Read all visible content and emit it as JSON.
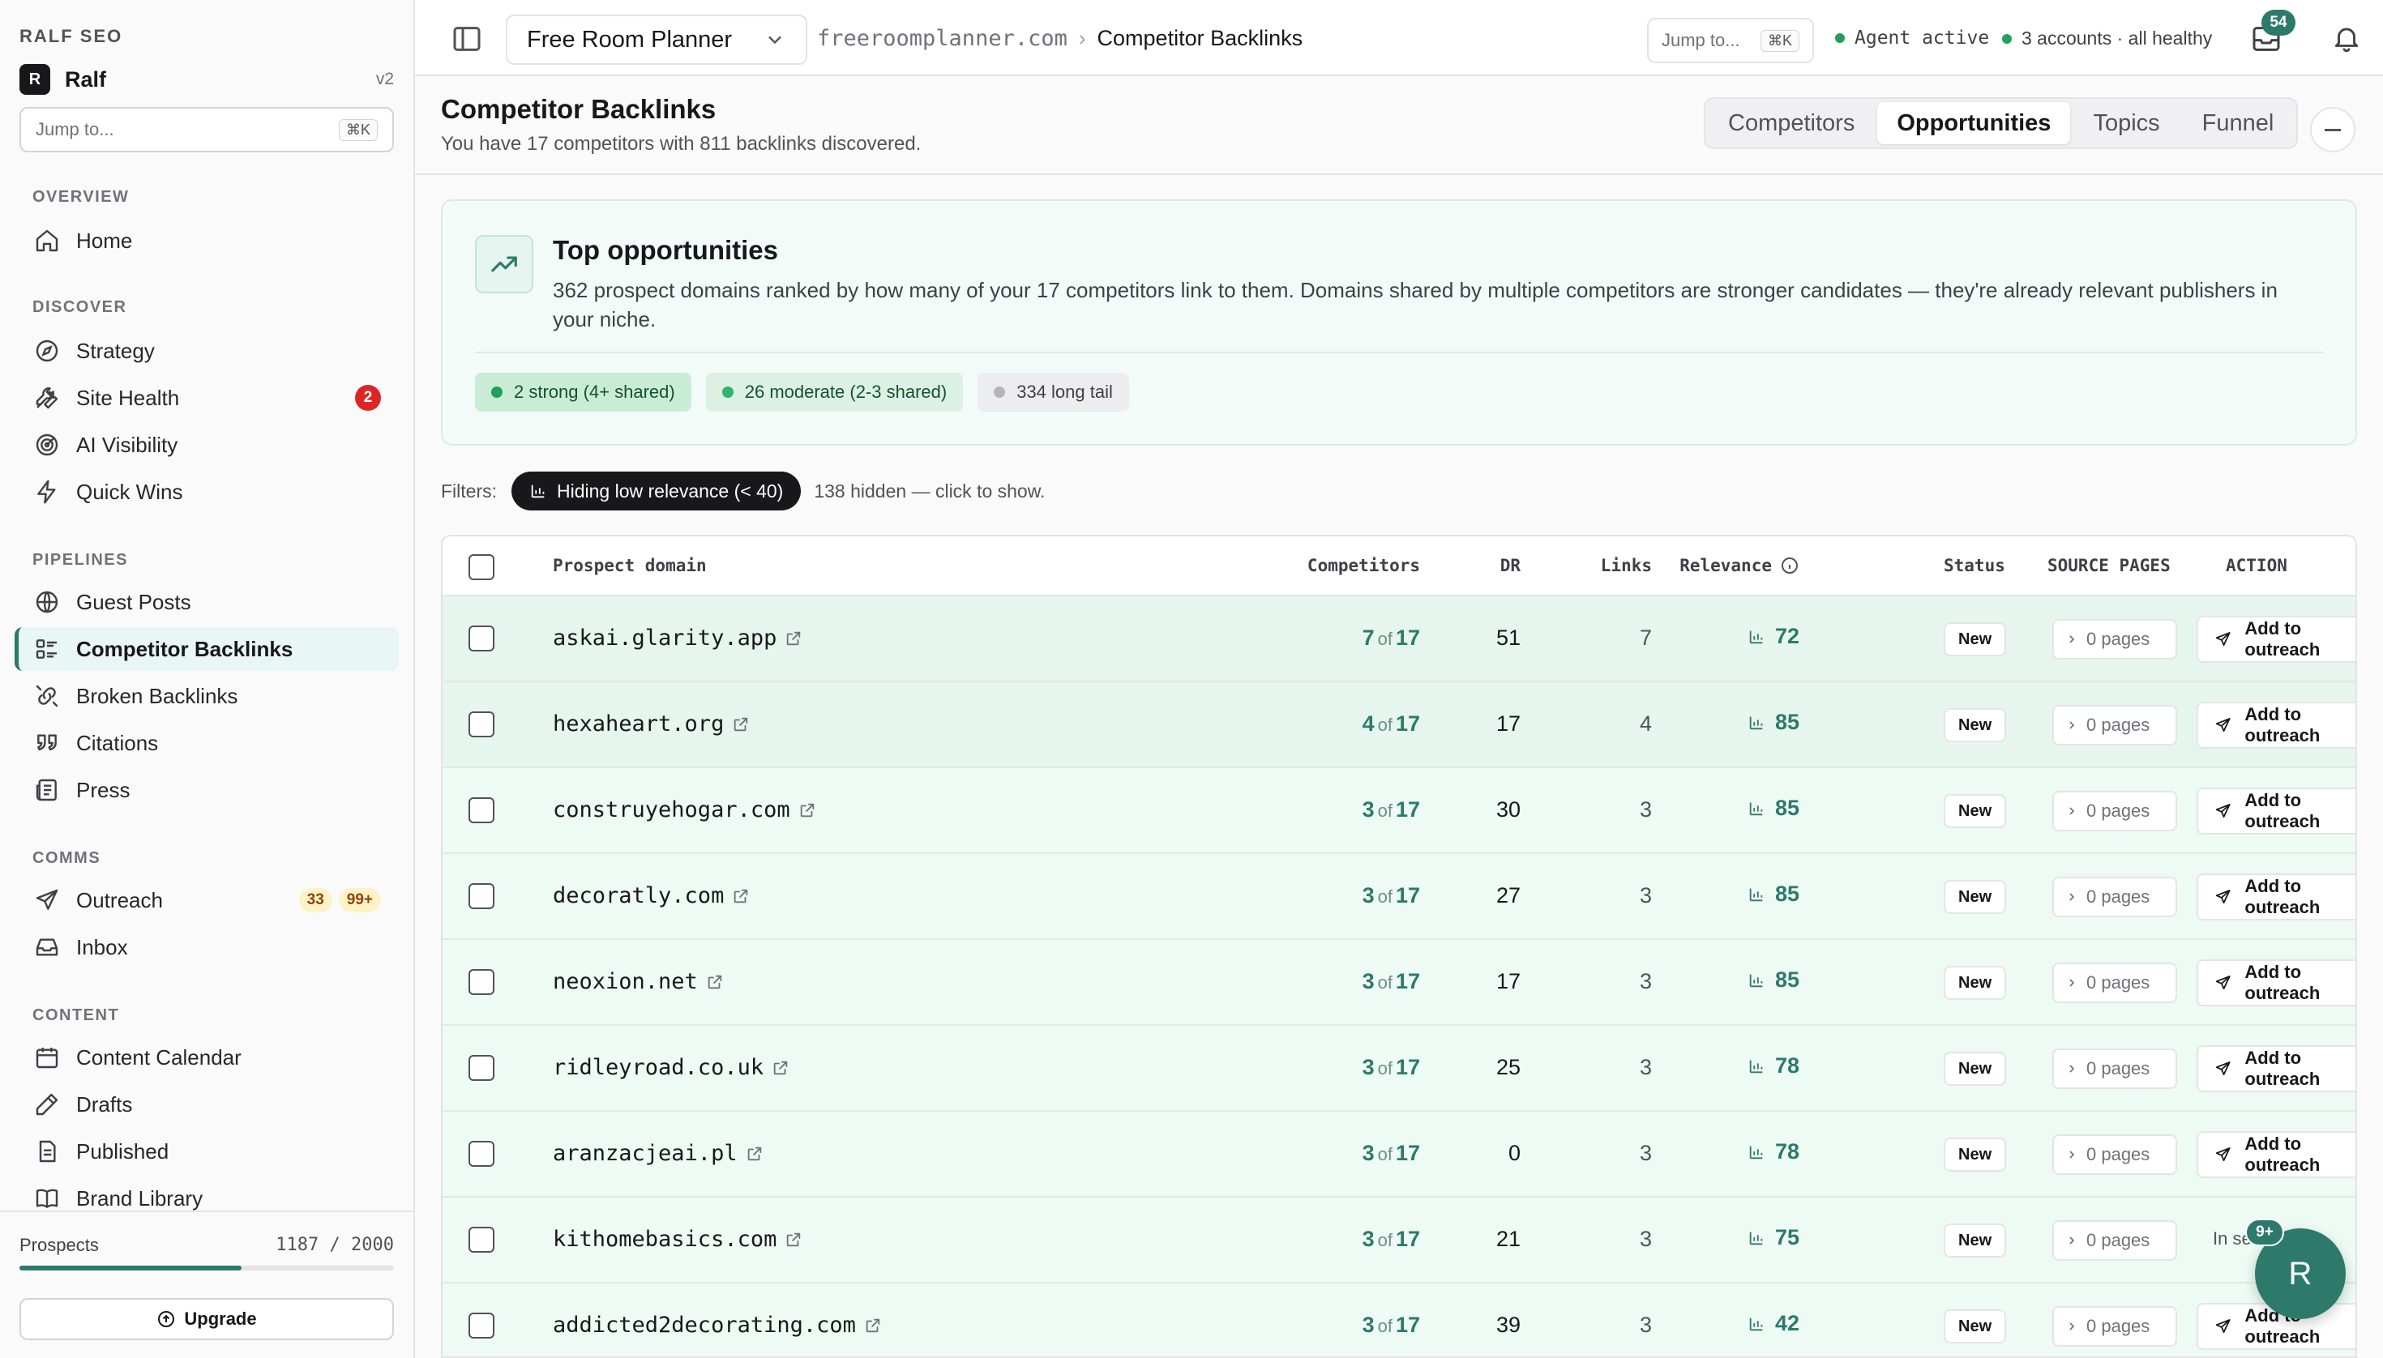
{
  "sidebar": {
    "brand_top": "RALF SEO",
    "brand_avatar": "R",
    "brand_name": "Ralf",
    "version": "v2",
    "jump_placeholder": "Jump to...",
    "jump_shortcut": "⌘K",
    "sections": {
      "overview": "OVERVIEW",
      "discover": "DISCOVER",
      "pipelines": "PIPELINES",
      "comms": "COMMS",
      "content": "CONTENT"
    },
    "items": {
      "home": {
        "label": "Home",
        "icon": "home-icon"
      },
      "strategy": {
        "label": "Strategy",
        "icon": "compass-icon"
      },
      "site_health": {
        "label": "Site Health",
        "icon": "wrench-icon",
        "badge": "2"
      },
      "ai_visibility": {
        "label": "AI Visibility",
        "icon": "radar-icon"
      },
      "quick_wins": {
        "label": "Quick Wins",
        "icon": "lightning-icon"
      },
      "guest_posts": {
        "label": "Guest Posts",
        "icon": "globe-icon"
      },
      "competitor_backlinks": {
        "label": "Competitor Backlinks",
        "icon": "list-icon",
        "active": true
      },
      "broken_backlinks": {
        "label": "Broken Backlinks",
        "icon": "broken-link-icon"
      },
      "citations": {
        "label": "Citations",
        "icon": "quote-icon"
      },
      "press": {
        "label": "Press",
        "icon": "newspaper-icon"
      },
      "outreach": {
        "label": "Outreach",
        "icon": "send-icon",
        "badge_a": "33",
        "badge_b": "99+"
      },
      "inbox": {
        "label": "Inbox",
        "icon": "inbox-icon"
      },
      "content_calendar": {
        "label": "Content Calendar",
        "icon": "calendar-icon"
      },
      "drafts": {
        "label": "Drafts",
        "icon": "pen-icon"
      },
      "published": {
        "label": "Published",
        "icon": "document-icon"
      },
      "brand_library": {
        "label": "Brand Library",
        "icon": "book-icon"
      }
    },
    "footer": {
      "prospects_label": "Prospects",
      "prospects_value": "1187 / 2000",
      "prospects_fraction": 0.5935,
      "upgrade_label": "Upgrade"
    }
  },
  "topbar": {
    "project": "Free Room Planner",
    "breadcrumb_domain": "freeroomplanner.com",
    "breadcrumb_page": "Competitor Backlinks",
    "jump_placeholder": "Jump to...",
    "jump_shortcut": "⌘K",
    "agent_status": "Agent active",
    "accounts_status": "3 accounts · all healthy",
    "inbox_count": "54"
  },
  "page": {
    "title": "Competitor Backlinks",
    "subtitle": "You have 17 competitors with 811 backlinks discovered.",
    "tabs": [
      "Competitors",
      "Opportunities",
      "Topics",
      "Funnel"
    ],
    "active_tab": "Opportunities"
  },
  "opportunities": {
    "title": "Top opportunities",
    "description": "362 prospect domains ranked by how many of your 17 competitors link to them. Domains shared by multiple competitors are stronger candidates — they're already relevant publishers in your niche.",
    "chips": {
      "strong": "2 strong (4+ shared)",
      "moderate": "26 moderate (2-3 shared)",
      "tail": "334 long tail"
    }
  },
  "filters": {
    "label": "Filters:",
    "pill": "Hiding low relevance (< 40)",
    "note": "138 hidden — click to show."
  },
  "table": {
    "headers": {
      "domain": "Prospect domain",
      "competitors": "Competitors",
      "dr": "DR",
      "links": "Links",
      "relevance": "Relevance",
      "status": "Status",
      "source_pages": "SOURCE PAGES",
      "action": "ACTION"
    },
    "of_word": "of",
    "rows": [
      {
        "domain": "askai.glarity.app",
        "comp": "7",
        "total": "17",
        "dr": "51",
        "links": "7",
        "relevance": "72",
        "status": "New",
        "pages": "0 pages",
        "action": "Add to outreach",
        "tier": "strong"
      },
      {
        "domain": "hexaheart.org",
        "comp": "4",
        "total": "17",
        "dr": "17",
        "links": "4",
        "relevance": "85",
        "status": "New",
        "pages": "0 pages",
        "action": "Add to outreach",
        "tier": "strong"
      },
      {
        "domain": "construyehogar.com",
        "comp": "3",
        "total": "17",
        "dr": "30",
        "links": "3",
        "relevance": "85",
        "status": "New",
        "pages": "0 pages",
        "action": "Add to outreach",
        "tier": "mod"
      },
      {
        "domain": "decoratly.com",
        "comp": "3",
        "total": "17",
        "dr": "27",
        "links": "3",
        "relevance": "85",
        "status": "New",
        "pages": "0 pages",
        "action": "Add to outreach",
        "tier": "mod"
      },
      {
        "domain": "neoxion.net",
        "comp": "3",
        "total": "17",
        "dr": "17",
        "links": "3",
        "relevance": "85",
        "status": "New",
        "pages": "0 pages",
        "action": "Add to outreach",
        "tier": "mod"
      },
      {
        "domain": "ridleyroad.co.uk",
        "comp": "3",
        "total": "17",
        "dr": "25",
        "links": "3",
        "relevance": "78",
        "status": "New",
        "pages": "0 pages",
        "action": "Add to outreach",
        "tier": "mod"
      },
      {
        "domain": "aranzacjeai.pl",
        "comp": "3",
        "total": "17",
        "dr": "0",
        "links": "3",
        "relevance": "78",
        "status": "New",
        "pages": "0 pages",
        "action": "Add to outreach",
        "tier": "mod"
      },
      {
        "domain": "kithomebasics.com",
        "comp": "3",
        "total": "17",
        "dr": "21",
        "links": "3",
        "relevance": "75",
        "status": "New",
        "pages": "0 pages",
        "action": "In se",
        "tier": "mod"
      },
      {
        "domain": "addicted2decorating.com",
        "comp": "3",
        "total": "17",
        "dr": "39",
        "links": "3",
        "relevance": "42",
        "status": "New",
        "pages": "0 pages",
        "action": "Add to outreach",
        "tier": "mod"
      }
    ]
  },
  "floating": {
    "avatar": "R",
    "badge": "9+"
  },
  "colors": {
    "accent": "#2d7a6b",
    "strong_row": "#e6f6ee",
    "moderate_row": "#eefaf4",
    "danger": "#dc2626"
  }
}
